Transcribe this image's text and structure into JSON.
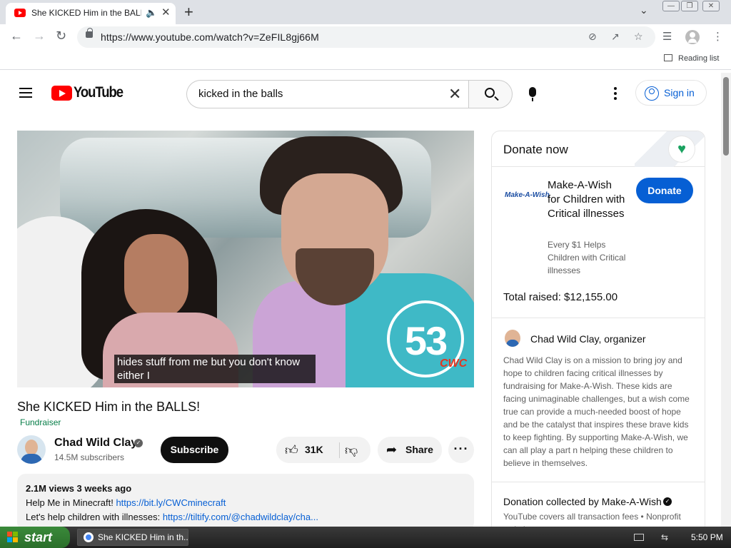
{
  "browser": {
    "tab_title": "She KICKED Him in the BALLS!",
    "url": "https://www.youtube.com/watch?v=ZeFIL8gj66M",
    "reading_list": "Reading list"
  },
  "header": {
    "logo_text": "YouTube",
    "search_value": "kicked in the balls",
    "signin_label": "Sign in"
  },
  "video": {
    "caption_line1": "hides stuff from me but you don't know",
    "caption_line2": "either I",
    "badge_number": "53",
    "badge_mark": "CWC",
    "title": "She KICKED Him in the BALLS!",
    "fundraiser_label": "Fundraiser"
  },
  "channel": {
    "name": "Chad Wild Clay",
    "subscribers": "14.5M subscribers",
    "subscribe_label": "Subscribe"
  },
  "actions": {
    "like_count": "31K",
    "share_label": "Share"
  },
  "description": {
    "meta": "2.1M views  3 weeks ago",
    "line1_text": "Help Me in Minecraft! ",
    "line1_link": "https://bit.ly/CWCminecraft",
    "line2_text": "Let's help children with illnesses: ",
    "line2_link": "https://tiltify.com/@chadwildclay/cha..."
  },
  "donate": {
    "header": "Donate now",
    "org_logo": "Make-A-Wish",
    "org_name": "Make-A-Wish for Children with Critical illnesses",
    "button": "Donate",
    "tagline": "Every $1 Helps Children with Critical illnesses",
    "raised": "Total raised: $12,155.00",
    "organizer_name": "Chad Wild Clay",
    "organizer_suffix": ", organizer",
    "mission": "Chad Wild Clay is on a mission to bring joy and hope to children facing critical illnesses by fundraising for Make-A-Wish. These kids are facing unimaginable challenges, but a wish come true can provide a much-needed boost of hope and be the catalyst that inspires these brave kids to keep fighting. By supporting Make-A-Wish, we can all play a part n helping these children to believe in themselves.",
    "collected": "Donation collected by Make-A-Wish",
    "fees": "YouTube covers all transaction fees  •  Nonprofit website"
  },
  "taskbar": {
    "start_label": "start",
    "task_label": "She KICKED Him in th...",
    "time": "5:50 PM"
  },
  "colors": {
    "youtube_red": "#ff0000",
    "link_blue": "#065fd4",
    "fundraiser_green": "#067d47"
  }
}
